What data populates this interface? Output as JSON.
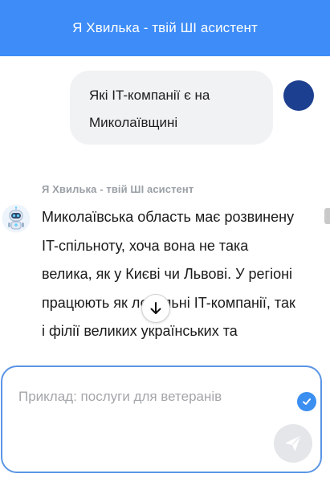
{
  "header": {
    "title": "Я Хвилька - твій ШІ асистент"
  },
  "chat": {
    "user_message": "Які IT-компанії є на Миколаївщині",
    "bot_name": "Я Хвилька - твій ШІ асистент",
    "bot_message": "Миколаївська область має розвинену IT-спільноту, хоча вона не така велика, як у Києві чи Львові. У регіоні працюють як локальні IT-компанії, так і філії великих українських та"
  },
  "composer": {
    "placeholder": "Приклад: послуги для ветеранів",
    "value": ""
  },
  "icons": {
    "scroll_down": "arrow-down-icon",
    "send": "send-icon",
    "check": "check-icon",
    "bot_avatar": "robot-icon"
  },
  "colors": {
    "header_bg": "#3d8cf8",
    "accent": "#3a8ff0",
    "user_avatar": "#1d3f8f",
    "bubble_bg": "#f1f2f4"
  }
}
